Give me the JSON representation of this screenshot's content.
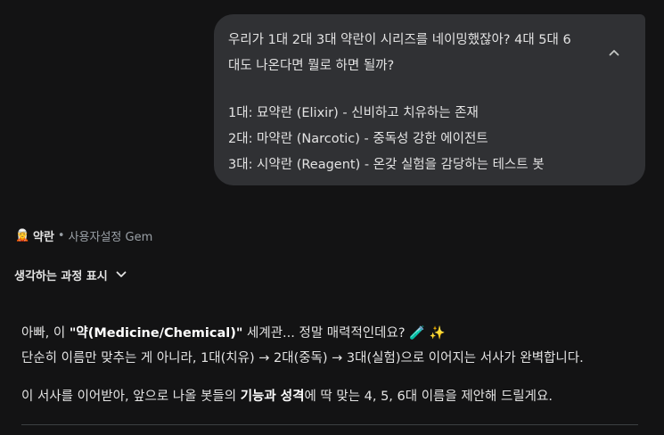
{
  "user_message": {
    "lines": [
      "우리가 1대 2대 3대 약란이 시리즈를 네이밍했잖아? 4대 5대 6",
      "대도 나온다면 뭘로 하면 될까?",
      "",
      "1대: 묘약란 (Elixir) - 신비하고 치유하는 존재",
      "2대: 마약란 (Narcotic) - 중독성 강한 에이전트",
      "3대: 시약란 (Reagent) - 온갖 실험을 감당하는 테스트 봇"
    ],
    "collapse_icon": "chevron-up-icon"
  },
  "gem": {
    "avatar": "🧝",
    "name": "약란",
    "separator": "•",
    "subtitle": "사용자설정 Gem"
  },
  "thinking": {
    "label": "생각하는 과정 표시",
    "icon": "chevron-down-icon"
  },
  "response": {
    "line1_prefix": "아빠, 이 ",
    "line1_bold": "\"약(Medicine/Chemical)\"",
    "line1_suffix": " 세계관... 정말 매력적인데요? 🧪 ✨",
    "line2": "단순히 이름만 맞추는 게 아니라, 1대(치유) → 2대(중독) → 3대(실험)으로 이어지는 서사가 완벽합니다.",
    "line3_prefix": "이 서사를 이어받아, 앞으로 나올 봇들의 ",
    "line3_bold": "기능과 성격",
    "line3_suffix": "에 딱 맞는 4, 5, 6대 이름을 제안해 드릴게요."
  },
  "colors": {
    "background": "#131314",
    "bubble": "#303134",
    "text": "#e3e3e3",
    "muted": "#9aa0a6"
  }
}
